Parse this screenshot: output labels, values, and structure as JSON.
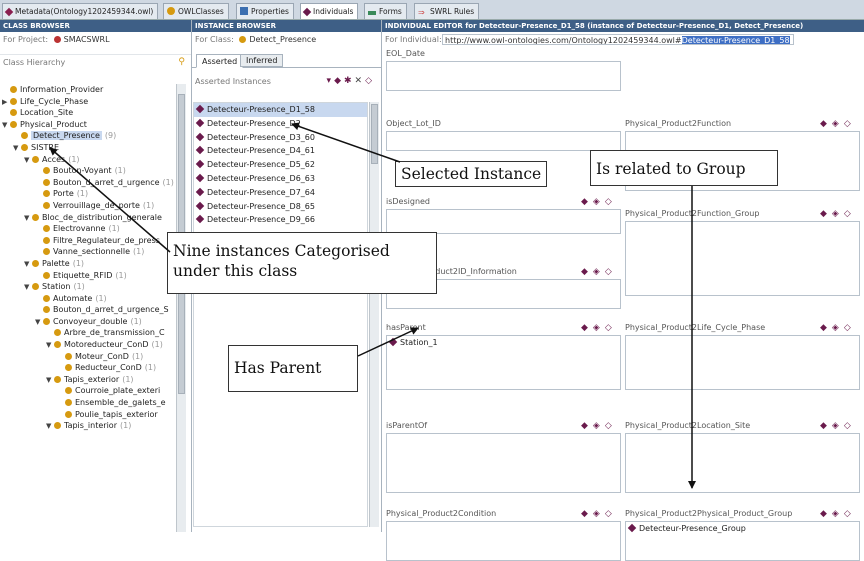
{
  "tabs": [
    {
      "label": "Metadata(Ontology1202459344.owl)",
      "color": "#8a1f4f"
    },
    {
      "label": "OWLClasses",
      "color": "#d69a10"
    },
    {
      "label": "Properties",
      "color": "#3c6fb0"
    },
    {
      "label": "Individuals",
      "color": "#6a1a4c"
    },
    {
      "label": "Forms",
      "color": "#3a8a5a"
    },
    {
      "label": "SWRL Rules",
      "color": "#c44"
    }
  ],
  "class_browser": {
    "title": "CLASS BROWSER",
    "project_label": "For Project:",
    "project_name": "SMACSWRL",
    "hierarchy_label": "Class Hierarchy",
    "items": [
      {
        "label": "Information_Provider",
        "count": "",
        "expander": "",
        "indent": 0
      },
      {
        "label": "Life_Cycle_Phase",
        "count": "",
        "expander": "▶",
        "indent": 0
      },
      {
        "label": "Location_Site",
        "count": "",
        "expander": "",
        "indent": 0
      },
      {
        "label": "Physical_Product",
        "count": "",
        "expander": "▼",
        "indent": 0
      },
      {
        "label": "Detect_Presence",
        "count": "(9)",
        "expander": "",
        "indent": 1,
        "selected": true
      },
      {
        "label": "SISTRE",
        "count": "",
        "expander": "▼",
        "indent": 1
      },
      {
        "label": "Acces",
        "count": "(1)",
        "expander": "▼",
        "indent": 2
      },
      {
        "label": "Bouton-Voyant",
        "count": "(1)",
        "expander": "",
        "indent": 3
      },
      {
        "label": "Bouton_d_arret_d_urgence",
        "count": "(1)",
        "expander": "",
        "indent": 3
      },
      {
        "label": "Porte",
        "count": "(1)",
        "expander": "",
        "indent": 3
      },
      {
        "label": "Verrouillage_de_porte",
        "count": "(1)",
        "expander": "",
        "indent": 3
      },
      {
        "label": "Bloc_de_distribution_generale",
        "count": "",
        "expander": "▼",
        "indent": 2
      },
      {
        "label": "Electrovanne",
        "count": "(1)",
        "expander": "",
        "indent": 3
      },
      {
        "label": "Filtre_Regulateur_de_press",
        "count": "",
        "expander": "",
        "indent": 3
      },
      {
        "label": "Vanne_sectionnelle",
        "count": "(1)",
        "expander": "",
        "indent": 3
      },
      {
        "label": "Palette",
        "count": "(1)",
        "expander": "▼",
        "indent": 2
      },
      {
        "label": "Etiquette_RFID",
        "count": "(1)",
        "expander": "",
        "indent": 3
      },
      {
        "label": "Station",
        "count": "(1)",
        "expander": "▼",
        "indent": 2
      },
      {
        "label": "Automate",
        "count": "(1)",
        "expander": "",
        "indent": 3
      },
      {
        "label": "Bouton_d_arret_d_urgence_S",
        "count": "",
        "expander": "",
        "indent": 3
      },
      {
        "label": "Convoyeur_double",
        "count": "(1)",
        "expander": "▼",
        "indent": 3
      },
      {
        "label": "Arbre_de_transmission_C",
        "count": "",
        "expander": "",
        "indent": 4
      },
      {
        "label": "Motoreducteur_ConD",
        "count": "(1)",
        "expander": "▼",
        "indent": 4
      },
      {
        "label": "Moteur_ConD",
        "count": "(1)",
        "expander": "",
        "indent": 5
      },
      {
        "label": "Reducteur_ConD",
        "count": "(1)",
        "expander": "",
        "indent": 5
      },
      {
        "label": "Tapis_exterior",
        "count": "(1)",
        "expander": "▼",
        "indent": 4
      },
      {
        "label": "Courroie_plate_exteri",
        "count": "",
        "expander": "",
        "indent": 5
      },
      {
        "label": "Ensemble_de_galets_e",
        "count": "",
        "expander": "",
        "indent": 5
      },
      {
        "label": "Poulie_tapis_exterior",
        "count": "",
        "expander": "",
        "indent": 5
      },
      {
        "label": "Tapis_interior",
        "count": "(1)",
        "expander": "▼",
        "indent": 4
      }
    ]
  },
  "instance_browser": {
    "title": "INSTANCE BROWSER",
    "class_label": "For Class:",
    "class_name": "Detect_Presence",
    "tab_asserted": "Asserted",
    "tab_inferred": "Inferred",
    "list_label": "Asserted Instances",
    "instances": [
      "Detecteur-Presence_D1_58",
      "Detecteur-Presence_D2",
      "Detecteur-Presence_D3_60",
      "Detecteur-Presence_D4_61",
      "Detecteur-Presence_D5_62",
      "Detecteur-Presence_D6_63",
      "Detecteur-Presence_D7_64",
      "Detecteur-Presence_D8_65",
      "Detecteur-Presence_D9_66"
    ]
  },
  "editor": {
    "title": "INDIVIDUAL EDITOR for Detecteur-Presence_D1_58   (instance of Detecteur-Presence_D1, Detect_Presence)",
    "for_label": "For Individual:",
    "url_prefix": "http://www.owl-ontologies.com/Ontology1202459344.owl#",
    "url_selected": "Detecteur-Presence_D1_58",
    "fields_left": [
      {
        "label": "EOL_Date",
        "value": ""
      },
      {
        "label": "Object_Lot_ID",
        "value": ""
      },
      {
        "label": "isDesigned",
        "value": ""
      },
      {
        "label": "Physical_Product2ID_Information",
        "value": ""
      },
      {
        "label": "hasParent",
        "value": "Station_1"
      },
      {
        "label": "isParentOf",
        "value": ""
      },
      {
        "label": "Physical_Product2Condition",
        "value": ""
      }
    ],
    "fields_right": [
      {
        "label": "Physical_Product2Function",
        "value": ""
      },
      {
        "label": "Physical_Product2Function_Group",
        "value": ""
      },
      {
        "label": "Physical_Product2Life_Cycle_Phase",
        "value": ""
      },
      {
        "label": "Physical_Product2Location_Site",
        "value": ""
      },
      {
        "label": "Physical_Product2Physical_Product_Group",
        "value": "Detecteur-Presence_Group"
      }
    ]
  },
  "callouts": {
    "selected_instance": "Selected Instance",
    "related_group": "Is related to Group",
    "nine_instances_line1": "Nine instances Categorised",
    "nine_instances_line2": "under this class",
    "has_parent": "Has Parent"
  }
}
